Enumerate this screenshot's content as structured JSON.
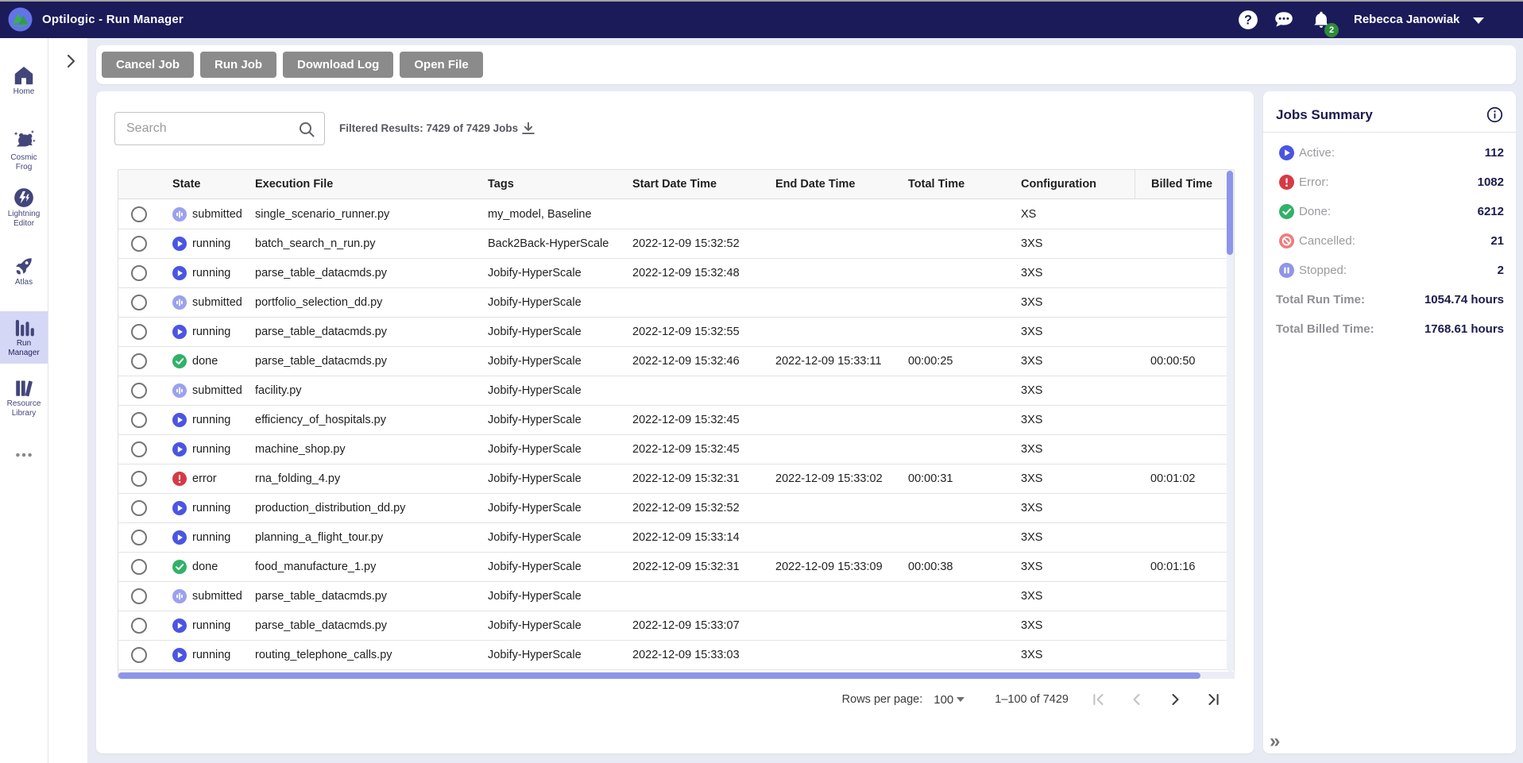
{
  "topbar": {
    "title": "Optilogic - Run Manager",
    "user_name": "Rebecca Janowiak",
    "notification_count": "2"
  },
  "sidebar": {
    "items": [
      {
        "id": "home",
        "label": "Home",
        "active": false
      },
      {
        "id": "cosmic-frog",
        "label": "Cosmic\nFrog",
        "active": false
      },
      {
        "id": "lightning-editor",
        "label": "Lightning\nEditor",
        "active": false
      },
      {
        "id": "atlas",
        "label": "Atlas",
        "active": false
      },
      {
        "id": "run-manager",
        "label": "Run\nManager",
        "active": true
      },
      {
        "id": "resource-library",
        "label": "Resource\nLibrary",
        "active": false
      },
      {
        "id": "more",
        "label": "",
        "active": false
      }
    ]
  },
  "toolbar": {
    "buttons": [
      "Cancel Job",
      "Run Job",
      "Download Log",
      "Open File"
    ]
  },
  "jobs": {
    "search_placeholder": "Search",
    "filtered_results": "Filtered Results: 7429 of 7429 Jobs",
    "columns": [
      "State",
      "Execution File",
      "Tags",
      "Start Date Time",
      "End Date Time",
      "Total Time",
      "Configuration",
      "Billed Time"
    ],
    "rows": [
      {
        "state": "submitted",
        "file": "single_scenario_runner.py",
        "tags": "my_model, Baseline",
        "start": "",
        "end": "",
        "total": "",
        "config": "XS",
        "billed": ""
      },
      {
        "state": "running",
        "file": "batch_search_n_run.py",
        "tags": "Back2Back-HyperScale",
        "start": "2022-12-09 15:32:52",
        "end": "",
        "total": "",
        "config": "3XS",
        "billed": ""
      },
      {
        "state": "running",
        "file": "parse_table_datacmds.py",
        "tags": "Jobify-HyperScale",
        "start": "2022-12-09 15:32:48",
        "end": "",
        "total": "",
        "config": "3XS",
        "billed": ""
      },
      {
        "state": "submitted",
        "file": "portfolio_selection_dd.py",
        "tags": "Jobify-HyperScale",
        "start": "",
        "end": "",
        "total": "",
        "config": "3XS",
        "billed": ""
      },
      {
        "state": "running",
        "file": "parse_table_datacmds.py",
        "tags": "Jobify-HyperScale",
        "start": "2022-12-09 15:32:55",
        "end": "",
        "total": "",
        "config": "3XS",
        "billed": ""
      },
      {
        "state": "done",
        "file": "parse_table_datacmds.py",
        "tags": "Jobify-HyperScale",
        "start": "2022-12-09 15:32:46",
        "end": "2022-12-09 15:33:11",
        "total": "00:00:25",
        "config": "3XS",
        "billed": "00:00:50"
      },
      {
        "state": "submitted",
        "file": "facility.py",
        "tags": "Jobify-HyperScale",
        "start": "",
        "end": "",
        "total": "",
        "config": "3XS",
        "billed": ""
      },
      {
        "state": "running",
        "file": "efficiency_of_hospitals.py",
        "tags": "Jobify-HyperScale",
        "start": "2022-12-09 15:32:45",
        "end": "",
        "total": "",
        "config": "3XS",
        "billed": ""
      },
      {
        "state": "running",
        "file": "machine_shop.py",
        "tags": "Jobify-HyperScale",
        "start": "2022-12-09 15:32:45",
        "end": "",
        "total": "",
        "config": "3XS",
        "billed": ""
      },
      {
        "state": "error",
        "file": "rna_folding_4.py",
        "tags": "Jobify-HyperScale",
        "start": "2022-12-09 15:32:31",
        "end": "2022-12-09 15:33:02",
        "total": "00:00:31",
        "config": "3XS",
        "billed": "00:01:02"
      },
      {
        "state": "running",
        "file": "production_distribution_dd.py",
        "tags": "Jobify-HyperScale",
        "start": "2022-12-09 15:32:52",
        "end": "",
        "total": "",
        "config": "3XS",
        "billed": ""
      },
      {
        "state": "running",
        "file": "planning_a_flight_tour.py",
        "tags": "Jobify-HyperScale",
        "start": "2022-12-09 15:33:14",
        "end": "",
        "total": "",
        "config": "3XS",
        "billed": ""
      },
      {
        "state": "done",
        "file": "food_manufacture_1.py",
        "tags": "Jobify-HyperScale",
        "start": "2022-12-09 15:32:31",
        "end": "2022-12-09 15:33:09",
        "total": "00:00:38",
        "config": "3XS",
        "billed": "00:01:16"
      },
      {
        "state": "submitted",
        "file": "parse_table_datacmds.py",
        "tags": "Jobify-HyperScale",
        "start": "",
        "end": "",
        "total": "",
        "config": "3XS",
        "billed": ""
      },
      {
        "state": "running",
        "file": "parse_table_datacmds.py",
        "tags": "Jobify-HyperScale",
        "start": "2022-12-09 15:33:07",
        "end": "",
        "total": "",
        "config": "3XS",
        "billed": ""
      },
      {
        "state": "running",
        "file": "routing_telephone_calls.py",
        "tags": "Jobify-HyperScale",
        "start": "2022-12-09 15:33:03",
        "end": "",
        "total": "",
        "config": "3XS",
        "billed": ""
      }
    ],
    "pagination": {
      "rows_per_page_label": "Rows per page:",
      "rows_per_page": "100",
      "range": "1–100 of 7429"
    }
  },
  "summary": {
    "title": "Jobs Summary",
    "stats": [
      {
        "icon": "running",
        "label": "Active:",
        "value": "112"
      },
      {
        "icon": "error",
        "label": "Error:",
        "value": "1082"
      },
      {
        "icon": "done",
        "label": "Done:",
        "value": "6212"
      },
      {
        "icon": "cancelled",
        "label": "Cancelled:",
        "value": "21"
      },
      {
        "icon": "stopped",
        "label": "Stopped:",
        "value": "2"
      }
    ],
    "totals": [
      {
        "label": "Total Run Time:",
        "value": "1054.74 hours"
      },
      {
        "label": "Total Billed Time:",
        "value": "1768.61 hours"
      }
    ]
  },
  "colors": {
    "topbar": "#1b1b5a",
    "page_bg": "#e9ebf4",
    "running": "#4a55e2",
    "submitted": "#9ba1ee",
    "done": "#32b169",
    "error": "#d63a45",
    "cancelled": "#ef7d7d",
    "stopped": "#9095e8",
    "scrollbar": "#8d95e9",
    "active_item_bg": "#d4d7f5",
    "navy_text": "#1a1b4e"
  }
}
